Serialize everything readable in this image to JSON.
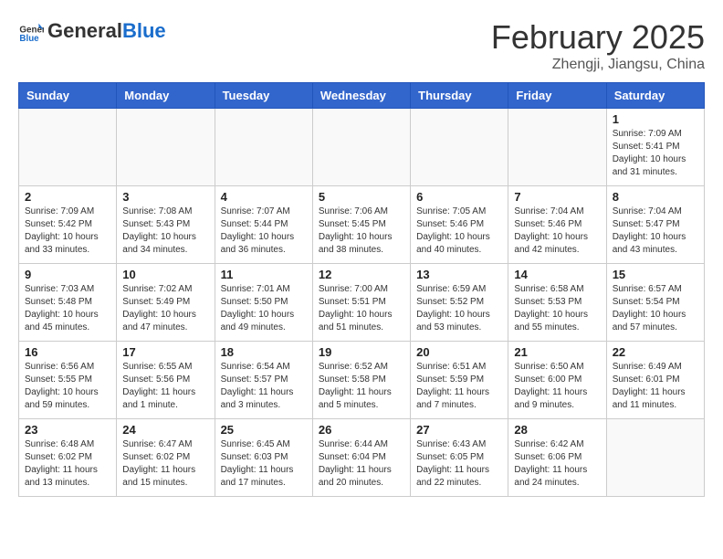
{
  "header": {
    "logo_line1": "General",
    "logo_line2": "Blue",
    "month_title": "February 2025",
    "subtitle": "Zhengji, Jiangsu, China"
  },
  "weekdays": [
    "Sunday",
    "Monday",
    "Tuesday",
    "Wednesday",
    "Thursday",
    "Friday",
    "Saturday"
  ],
  "weeks": [
    [
      {
        "day": "",
        "info": ""
      },
      {
        "day": "",
        "info": ""
      },
      {
        "day": "",
        "info": ""
      },
      {
        "day": "",
        "info": ""
      },
      {
        "day": "",
        "info": ""
      },
      {
        "day": "",
        "info": ""
      },
      {
        "day": "1",
        "info": "Sunrise: 7:09 AM\nSunset: 5:41 PM\nDaylight: 10 hours\nand 31 minutes."
      }
    ],
    [
      {
        "day": "2",
        "info": "Sunrise: 7:09 AM\nSunset: 5:42 PM\nDaylight: 10 hours\nand 33 minutes."
      },
      {
        "day": "3",
        "info": "Sunrise: 7:08 AM\nSunset: 5:43 PM\nDaylight: 10 hours\nand 34 minutes."
      },
      {
        "day": "4",
        "info": "Sunrise: 7:07 AM\nSunset: 5:44 PM\nDaylight: 10 hours\nand 36 minutes."
      },
      {
        "day": "5",
        "info": "Sunrise: 7:06 AM\nSunset: 5:45 PM\nDaylight: 10 hours\nand 38 minutes."
      },
      {
        "day": "6",
        "info": "Sunrise: 7:05 AM\nSunset: 5:46 PM\nDaylight: 10 hours\nand 40 minutes."
      },
      {
        "day": "7",
        "info": "Sunrise: 7:04 AM\nSunset: 5:46 PM\nDaylight: 10 hours\nand 42 minutes."
      },
      {
        "day": "8",
        "info": "Sunrise: 7:04 AM\nSunset: 5:47 PM\nDaylight: 10 hours\nand 43 minutes."
      }
    ],
    [
      {
        "day": "9",
        "info": "Sunrise: 7:03 AM\nSunset: 5:48 PM\nDaylight: 10 hours\nand 45 minutes."
      },
      {
        "day": "10",
        "info": "Sunrise: 7:02 AM\nSunset: 5:49 PM\nDaylight: 10 hours\nand 47 minutes."
      },
      {
        "day": "11",
        "info": "Sunrise: 7:01 AM\nSunset: 5:50 PM\nDaylight: 10 hours\nand 49 minutes."
      },
      {
        "day": "12",
        "info": "Sunrise: 7:00 AM\nSunset: 5:51 PM\nDaylight: 10 hours\nand 51 minutes."
      },
      {
        "day": "13",
        "info": "Sunrise: 6:59 AM\nSunset: 5:52 PM\nDaylight: 10 hours\nand 53 minutes."
      },
      {
        "day": "14",
        "info": "Sunrise: 6:58 AM\nSunset: 5:53 PM\nDaylight: 10 hours\nand 55 minutes."
      },
      {
        "day": "15",
        "info": "Sunrise: 6:57 AM\nSunset: 5:54 PM\nDaylight: 10 hours\nand 57 minutes."
      }
    ],
    [
      {
        "day": "16",
        "info": "Sunrise: 6:56 AM\nSunset: 5:55 PM\nDaylight: 10 hours\nand 59 minutes."
      },
      {
        "day": "17",
        "info": "Sunrise: 6:55 AM\nSunset: 5:56 PM\nDaylight: 11 hours\nand 1 minute."
      },
      {
        "day": "18",
        "info": "Sunrise: 6:54 AM\nSunset: 5:57 PM\nDaylight: 11 hours\nand 3 minutes."
      },
      {
        "day": "19",
        "info": "Sunrise: 6:52 AM\nSunset: 5:58 PM\nDaylight: 11 hours\nand 5 minutes."
      },
      {
        "day": "20",
        "info": "Sunrise: 6:51 AM\nSunset: 5:59 PM\nDaylight: 11 hours\nand 7 minutes."
      },
      {
        "day": "21",
        "info": "Sunrise: 6:50 AM\nSunset: 6:00 PM\nDaylight: 11 hours\nand 9 minutes."
      },
      {
        "day": "22",
        "info": "Sunrise: 6:49 AM\nSunset: 6:01 PM\nDaylight: 11 hours\nand 11 minutes."
      }
    ],
    [
      {
        "day": "23",
        "info": "Sunrise: 6:48 AM\nSunset: 6:02 PM\nDaylight: 11 hours\nand 13 minutes."
      },
      {
        "day": "24",
        "info": "Sunrise: 6:47 AM\nSunset: 6:02 PM\nDaylight: 11 hours\nand 15 minutes."
      },
      {
        "day": "25",
        "info": "Sunrise: 6:45 AM\nSunset: 6:03 PM\nDaylight: 11 hours\nand 17 minutes."
      },
      {
        "day": "26",
        "info": "Sunrise: 6:44 AM\nSunset: 6:04 PM\nDaylight: 11 hours\nand 20 minutes."
      },
      {
        "day": "27",
        "info": "Sunrise: 6:43 AM\nSunset: 6:05 PM\nDaylight: 11 hours\nand 22 minutes."
      },
      {
        "day": "28",
        "info": "Sunrise: 6:42 AM\nSunset: 6:06 PM\nDaylight: 11 hours\nand 24 minutes."
      },
      {
        "day": "",
        "info": ""
      }
    ]
  ]
}
